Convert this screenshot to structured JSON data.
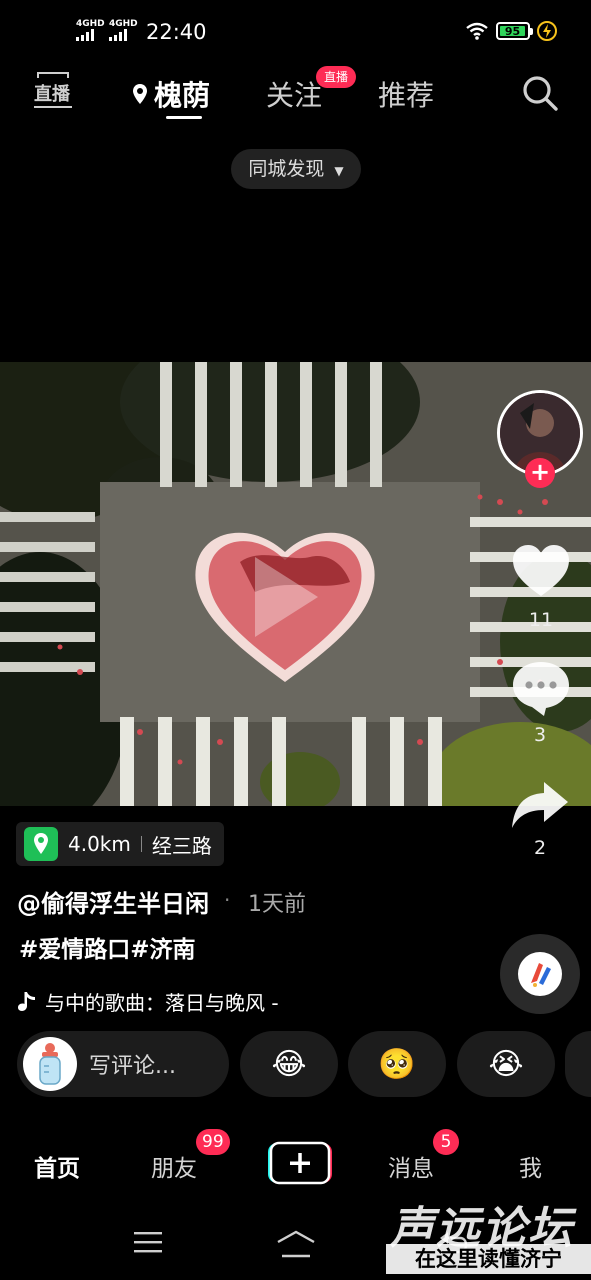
{
  "status_bar": {
    "signal_1": "4GHD",
    "signal_2": "4GHD",
    "time": "22:40",
    "battery": "95",
    "icons": [
      "wifi-icon",
      "battery-icon",
      "charging-bolt-icon"
    ]
  },
  "top_nav": {
    "live_label": "直播",
    "location_tab": "槐荫",
    "follow_tab": "关注",
    "follow_badge": "直播",
    "recommend_tab": "推荐",
    "search_icon": "search-icon",
    "chip_label": "同城发现"
  },
  "rail": {
    "like_count": "11",
    "comment_count": "3",
    "share_count": "2"
  },
  "post": {
    "distance": "4.0km",
    "place": "经三路",
    "author": "@偷得浮生半日闲",
    "time_ago": "1天前",
    "hashtags": "#爱情路口#济南",
    "music": "与中的歌曲：落日与晚风 -"
  },
  "reactions": {
    "comment_placeholder": "写评论...",
    "emojis": [
      "😂",
      "🥺",
      "😭"
    ]
  },
  "bottom_tabs": {
    "home": "首页",
    "friends": "朋友",
    "friends_badge": "99",
    "messages": "消息",
    "messages_badge": "5",
    "me": "我"
  },
  "watermark": {
    "line1": "声远论坛",
    "line2": "在这里读懂济宁"
  }
}
